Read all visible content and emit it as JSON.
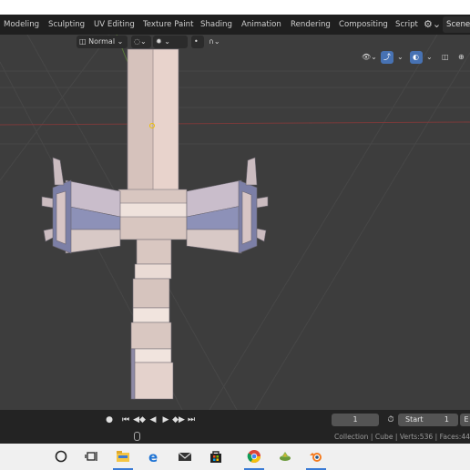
{
  "top_tabs": [
    "Modeling",
    "Sculpting",
    "UV Editing",
    "Texture Paint",
    "Shading",
    "Animation",
    "Rendering",
    "Compositing",
    "Script"
  ],
  "scene_label": "Scene",
  "viewport_header": {
    "orientation_label": "Normal"
  },
  "timeline": {
    "current_frame": "1",
    "start_label": "Start",
    "start_value": "1",
    "end_label_partial": "E"
  },
  "status": {
    "text": "Collection | Cube | Verts:536 | Faces:44"
  },
  "taskbar": {
    "apps": [
      "cortana-icon",
      "task-view-icon",
      "file-explorer-icon",
      "edge-icon",
      "mail-icon",
      "store-icon",
      "chrome-icon",
      "app-icon",
      "blender-icon"
    ]
  },
  "colors": {
    "viewport_bg": "#3d3d3d",
    "topbar_bg": "#1f1f1f",
    "active_blue": "#4772b3",
    "mesh_light": "#e8d7d0",
    "mesh_shadow": "#8a8fb5"
  }
}
